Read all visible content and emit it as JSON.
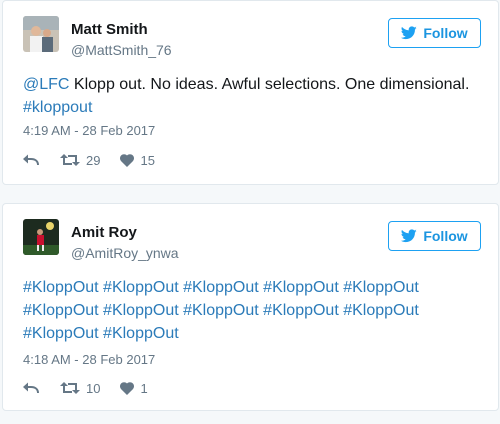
{
  "tweets": [
    {
      "name": "Matt Smith",
      "handle": "@MattSmith_76",
      "follow_label": "Follow",
      "text": [
        {
          "t": "@LFC",
          "link": true
        },
        {
          "t": " Klopp out. No ideas. Awful selections. One dimensional. ",
          "link": false
        },
        {
          "t": "#kloppout",
          "link": true
        }
      ],
      "time": "4:19 AM - 28 Feb 2017",
      "retweets": "29",
      "likes": "15"
    },
    {
      "name": "Amit Roy",
      "handle": "@AmitRoy_ynwa",
      "follow_label": "Follow",
      "text": [
        {
          "t": "#KloppOut #KloppOut #KloppOut #KloppOut #KloppOut #KloppOut #KloppOut #KloppOut #KloppOut #KloppOut #KloppOut #KloppOut",
          "link": true
        }
      ],
      "time": "4:18 AM - 28 Feb 2017",
      "retweets": "10",
      "likes": "1"
    }
  ],
  "colors": {
    "link": "#2b7bb9",
    "follow": "#1da1f2",
    "meta": "#657786"
  },
  "icons": [
    "twitter-bird-icon",
    "reply-icon",
    "retweet-icon",
    "heart-icon"
  ]
}
